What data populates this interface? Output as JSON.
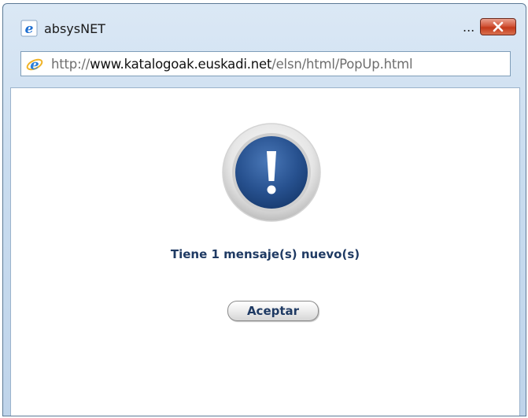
{
  "window": {
    "title": "absysNET",
    "title_ellipsis": "...",
    "close_icon": "close-icon"
  },
  "address_bar": {
    "url_prefix": "http://",
    "url_host": "www.katalogoak.euskadi.net",
    "url_path": "/elsn/html/PopUp.html",
    "icon": "ie-icon"
  },
  "dialog": {
    "icon": "exclamation-icon",
    "message": "Tiene 1 mensaje(s) nuevo(s)",
    "accept_label": "Aceptar"
  },
  "colors": {
    "accent_blue": "#1f3a63",
    "close_red": "#c3391a",
    "frame": "#c9dcef"
  }
}
